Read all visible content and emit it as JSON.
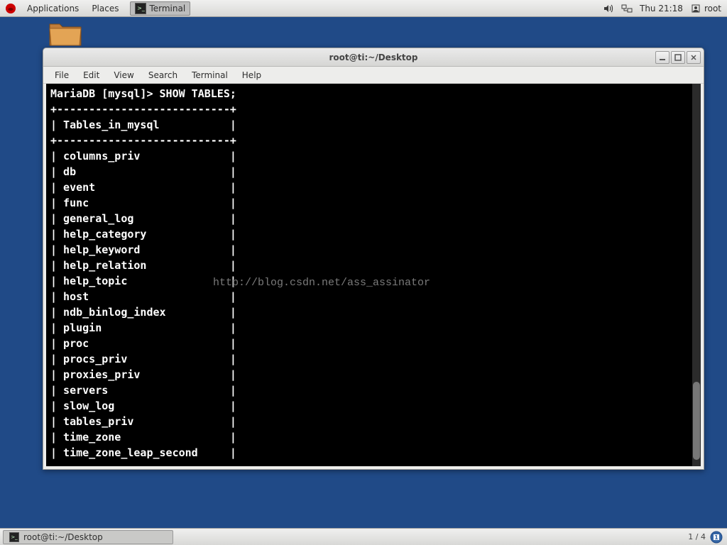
{
  "top_panel": {
    "applications": "Applications",
    "places": "Places",
    "task_label": "Terminal",
    "clock": "Thu 21:18",
    "user": "root"
  },
  "window": {
    "title": "root@ti:~/Desktop",
    "menu": {
      "file": "File",
      "edit": "Edit",
      "view": "View",
      "search": "Search",
      "terminal": "Terminal",
      "help": "Help"
    }
  },
  "terminal": {
    "prompt": "MariaDB [mysql]> ",
    "command": "SHOW TABLES;",
    "border": "+---------------------------+",
    "header": "Tables_in_mysql",
    "rows": [
      "columns_priv",
      "db",
      "event",
      "func",
      "general_log",
      "help_category",
      "help_keyword",
      "help_relation",
      "help_topic",
      "host",
      "ndb_binlog_index",
      "plugin",
      "proc",
      "procs_priv",
      "proxies_priv",
      "servers",
      "slow_log",
      "tables_priv",
      "time_zone",
      "time_zone_leap_second"
    ]
  },
  "watermark": "http://blog.csdn.net/ass_assinator",
  "bottom_panel": {
    "task_label": "root@ti:~/Desktop",
    "workspace": "1 / 4"
  }
}
